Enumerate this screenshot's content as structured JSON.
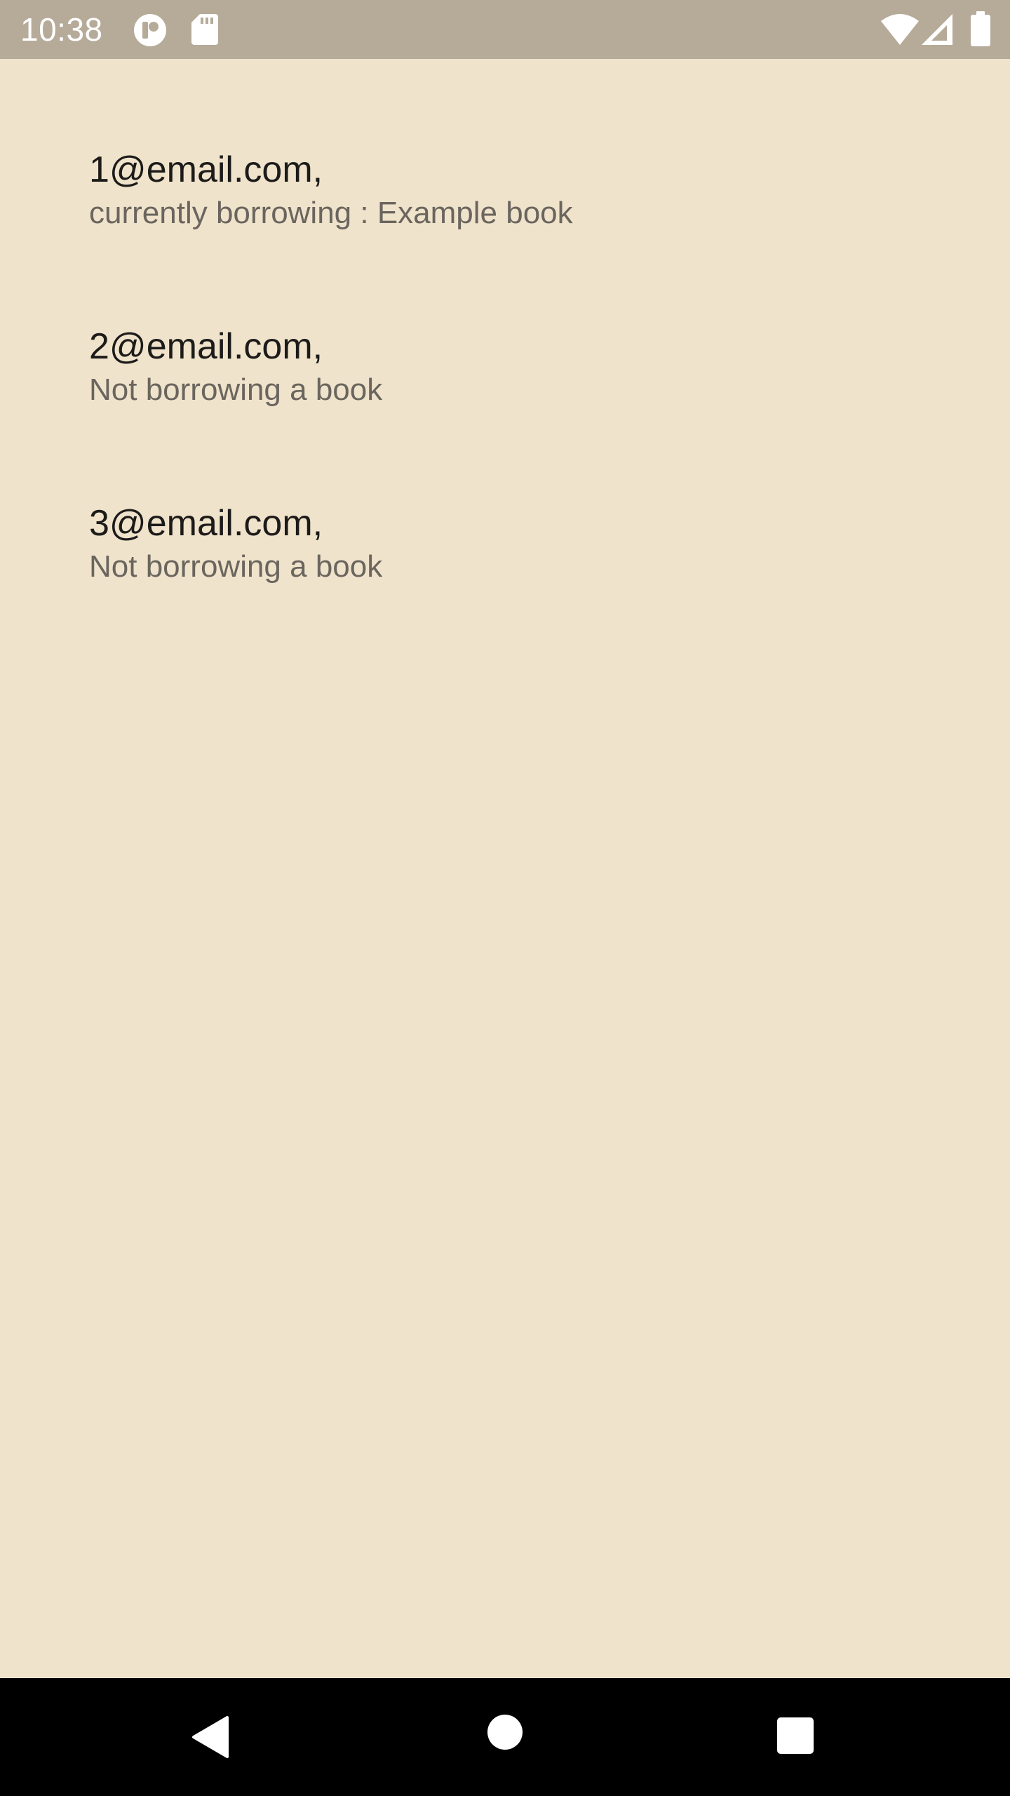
{
  "status_bar": {
    "time": "10:38",
    "icons_left": [
      "app-notification-icon",
      "sd-card-icon"
    ],
    "icons_right": [
      "wifi-icon",
      "cellular-signal-icon",
      "battery-icon"
    ]
  },
  "list": {
    "items": [
      {
        "title": "1@email.com,",
        "subtitle": "currently borrowing : Example book"
      },
      {
        "title": "2@email.com,",
        "subtitle": "Not borrowing a book"
      },
      {
        "title": "3@email.com,",
        "subtitle": "Not borrowing a book"
      }
    ]
  },
  "nav_bar": {
    "buttons": [
      "back-icon",
      "home-icon",
      "recents-icon"
    ]
  },
  "colors": {
    "background": "#f0e3cb",
    "status_bar": "#b6ab99",
    "title_text": "#1c1b1a",
    "subtitle_text": "#6a655e",
    "nav_bar": "#000000"
  }
}
